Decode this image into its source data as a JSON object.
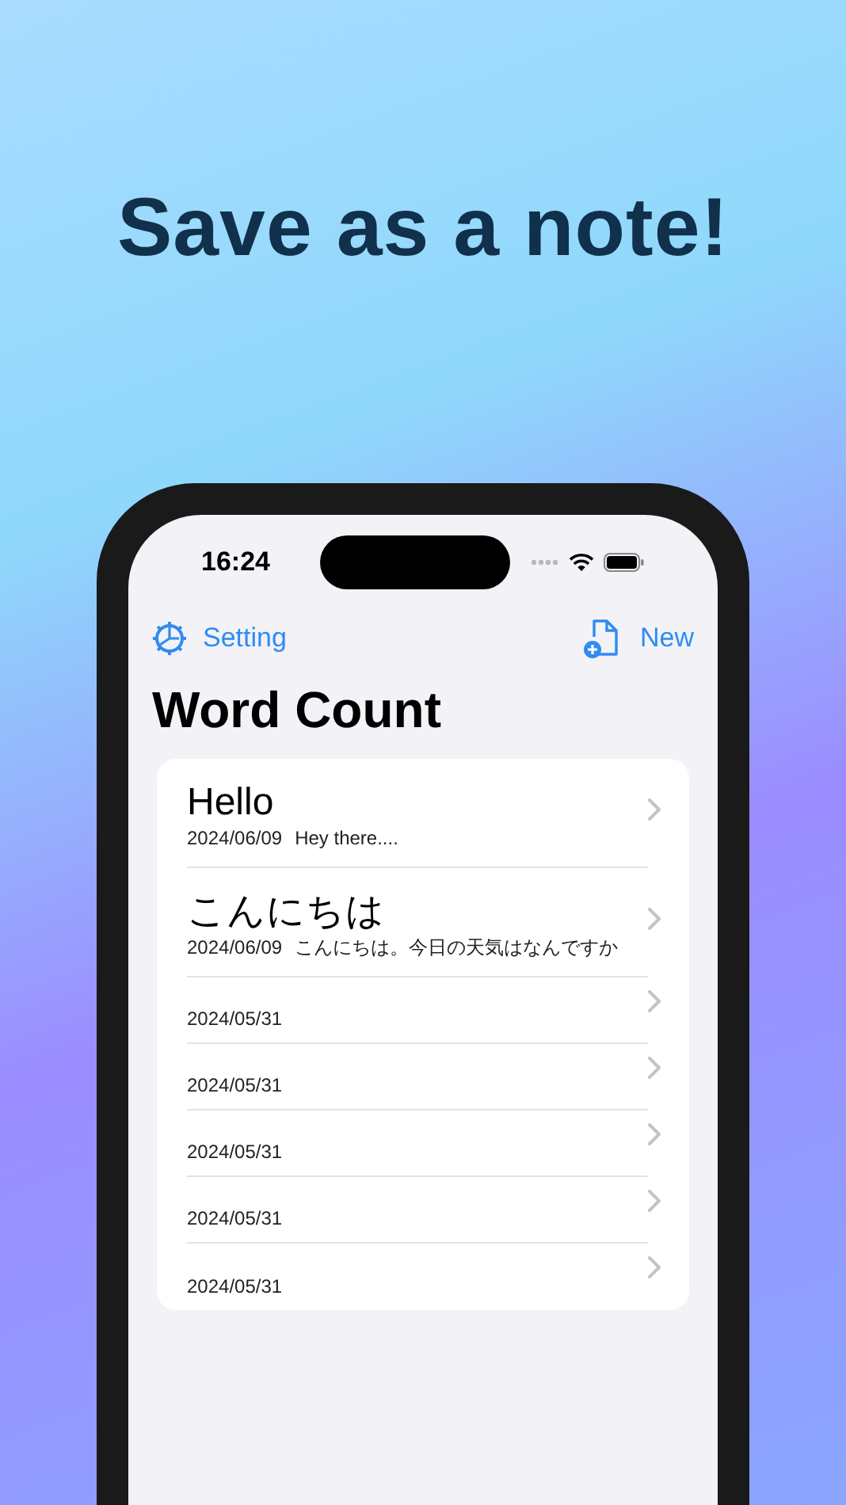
{
  "headline": "Save as a note!",
  "status_bar": {
    "time": "16:24"
  },
  "nav": {
    "left_button": "Setting",
    "right_button": "New",
    "title": "Word Count"
  },
  "notes": [
    {
      "title": "Hello",
      "date": "2024/06/09",
      "preview": "Hey there...."
    },
    {
      "title": "こんにちは",
      "date": "2024/06/09",
      "preview": "こんにちは。今日の天気はなんですか"
    },
    {
      "date": "2024/05/31"
    },
    {
      "date": "2024/05/31"
    },
    {
      "date": "2024/05/31"
    },
    {
      "date": "2024/05/31"
    },
    {
      "date": "2024/05/31"
    }
  ]
}
